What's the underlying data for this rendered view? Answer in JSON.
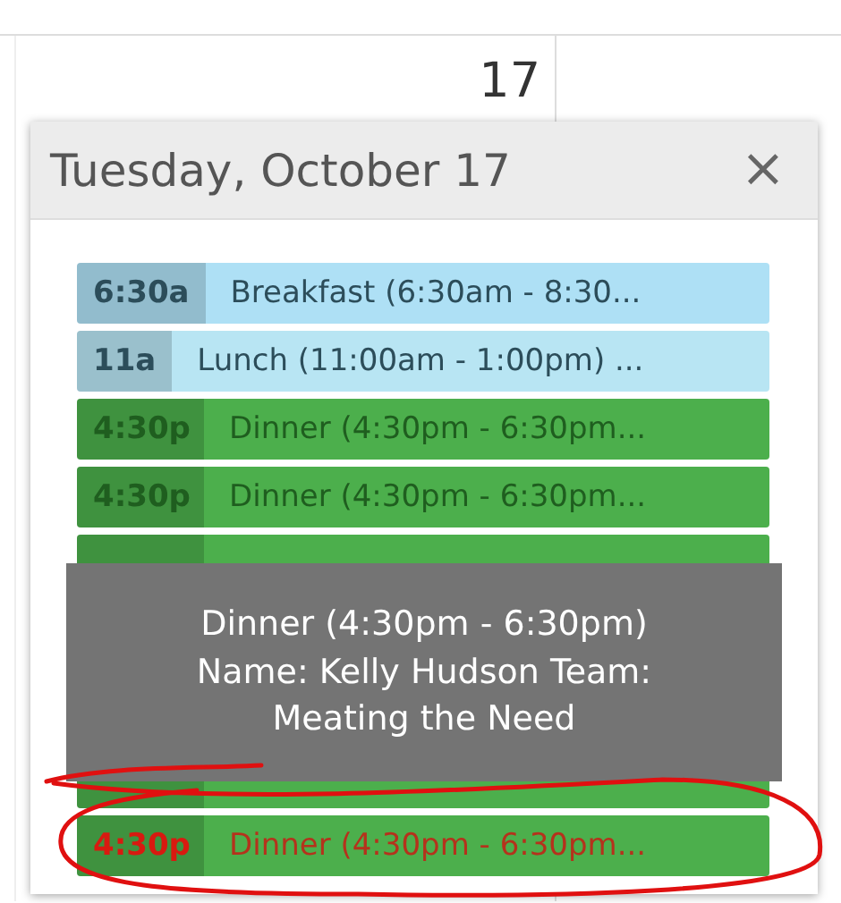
{
  "calendar": {
    "day_number": "17"
  },
  "popover": {
    "title": "Tuesday, October 17",
    "close": "×",
    "events": [
      {
        "kind": "meal",
        "time": "6:30a",
        "label": "Breakfast (6:30am - 8:30...",
        "color": "#aee0f5",
        "highlighted": false
      },
      {
        "kind": "meal",
        "time": "11a",
        "label": "Lunch (11:00am - 1:00pm) ...",
        "color": "#b8e5f3",
        "highlighted": false
      },
      {
        "kind": "meal",
        "time": "4:30p",
        "label": "Dinner (4:30pm - 6:30pm...",
        "color": "#4caf4c",
        "highlighted": false
      },
      {
        "kind": "meal",
        "time": "4:30p",
        "label": "Dinner (4:30pm - 6:30pm...",
        "color": "#4caf4c",
        "highlighted": false
      },
      {
        "kind": "obscured",
        "color": "#4caf4c"
      },
      {
        "kind": "obscured",
        "color": "#4caf4c"
      },
      {
        "kind": "meal",
        "time": "4:30p",
        "label": "Dinner (4:30pm - 6:30pm...",
        "color": "#4caf4c",
        "highlighted": true
      }
    ],
    "tooltip": {
      "lines": [
        "Dinner (4:30pm - 6:30pm)",
        "Name: Kelly Hudson Team:",
        "Meating the Need"
      ]
    }
  },
  "annotation": {
    "kind": "ellipse"
  }
}
